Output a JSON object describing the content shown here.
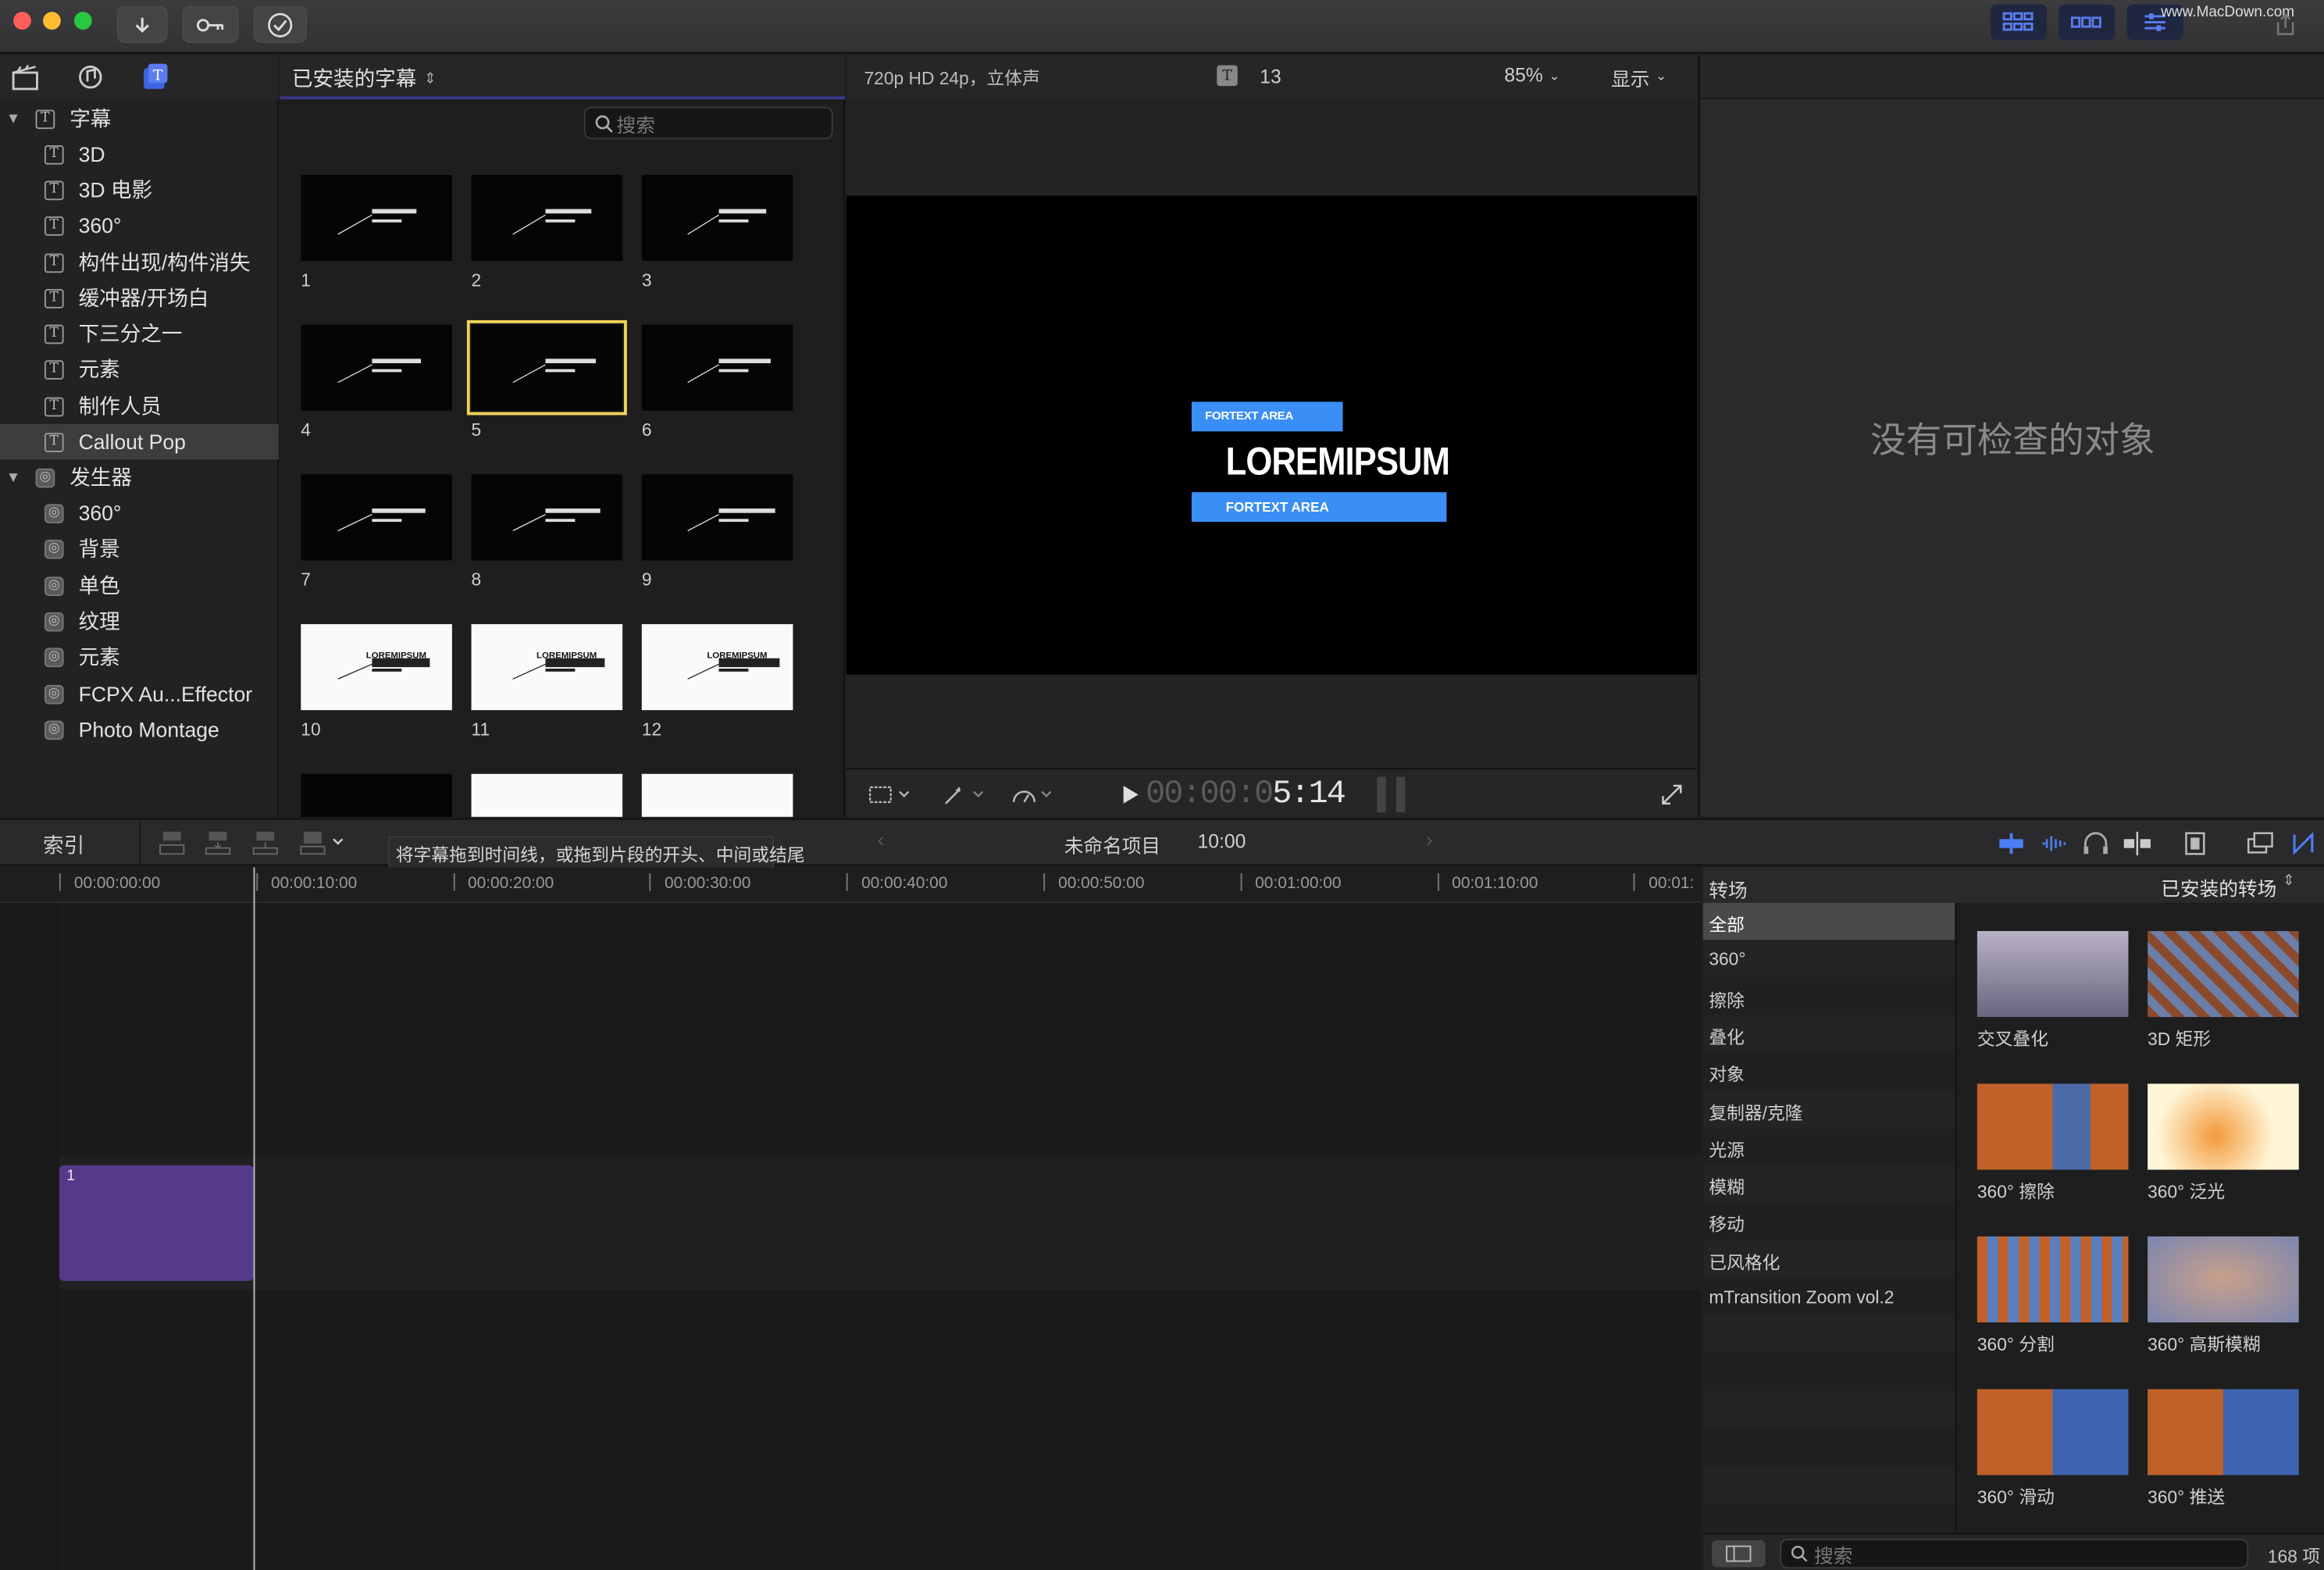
{
  "toolbar": {
    "watermark": "www.MacDown.com",
    "icons": [
      "download-icon",
      "key-icon",
      "checkmark-icon"
    ],
    "right_icons": [
      "grid-view-icon",
      "filmstrip-view-icon",
      "inspector-icon",
      "share-icon"
    ],
    "accent": "#5a7cf0"
  },
  "library": {
    "tab_icons": [
      "clapper-icon",
      "music-photo-icon",
      "titles-icon"
    ],
    "groups": [
      {
        "label": "字幕",
        "items": [
          "3D",
          "3D 电影",
          "360°",
          "构件出现/构件消失",
          "缓冲器/开场白",
          "下三分之一",
          "元素",
          "制作人员",
          "Callout Pop"
        ]
      },
      {
        "label": "发生器",
        "items": [
          "360°",
          "背景",
          "单色",
          "纹理",
          "元素",
          "FCPX Au...Effector",
          "Photo Montage"
        ]
      }
    ],
    "selected": "Callout Pop"
  },
  "browser": {
    "source": "已安装的字幕",
    "search_placeholder": "搜索",
    "thumbs": [
      "1",
      "2",
      "3",
      "4",
      "5",
      "6",
      "7",
      "8",
      "9",
      "10",
      "11",
      "12"
    ],
    "selected": "5",
    "thumb_text_sample": "LOREMIPSUM"
  },
  "viewer": {
    "format": "720p HD 24p，立体声",
    "title_count": "13",
    "zoom": "85%",
    "display_label": "显示",
    "title_tag1": "FORTEXT AREA",
    "title_main": "LOREMIPSUM",
    "title_tag2": "FORTEXT AREA",
    "tag_color": "#3a8ef5",
    "timecode_dim": "00:00:0",
    "timecode_bright": "5:14"
  },
  "inspector": {
    "empty_text": "没有可检查的对象"
  },
  "timeline_bar": {
    "index_label": "索引",
    "tooltip": "将字幕拖到时间线，或拖到片段的开头、中间或结尾",
    "project_name": "未命名项目",
    "project_duration": "10:00"
  },
  "ruler": [
    "00:00:00:00",
    "00:00:10:00",
    "00:00:20:00",
    "00:00:30:00",
    "00:00:40:00",
    "00:00:50:00",
    "00:01:00:00",
    "00:01:10:00",
    "00:01:"
  ],
  "clip": {
    "label": "1",
    "color": "#55398a"
  },
  "transitions": {
    "header": "转场",
    "source": "已安装的转场",
    "categories": [
      "全部",
      "360°",
      "擦除",
      "叠化",
      "对象",
      "复制器/克隆",
      "光源",
      "模糊",
      "移动",
      "已风格化",
      "mTransition Zoom vol.2"
    ],
    "selected": "全部",
    "items": [
      "交叉叠化",
      "3D 矩形",
      "360° 擦除",
      "360° 泛光",
      "360° 分割",
      "360° 高斯模糊",
      "360° 滑动",
      "360° 推送"
    ],
    "search_placeholder": "搜索",
    "count": "168 项"
  }
}
